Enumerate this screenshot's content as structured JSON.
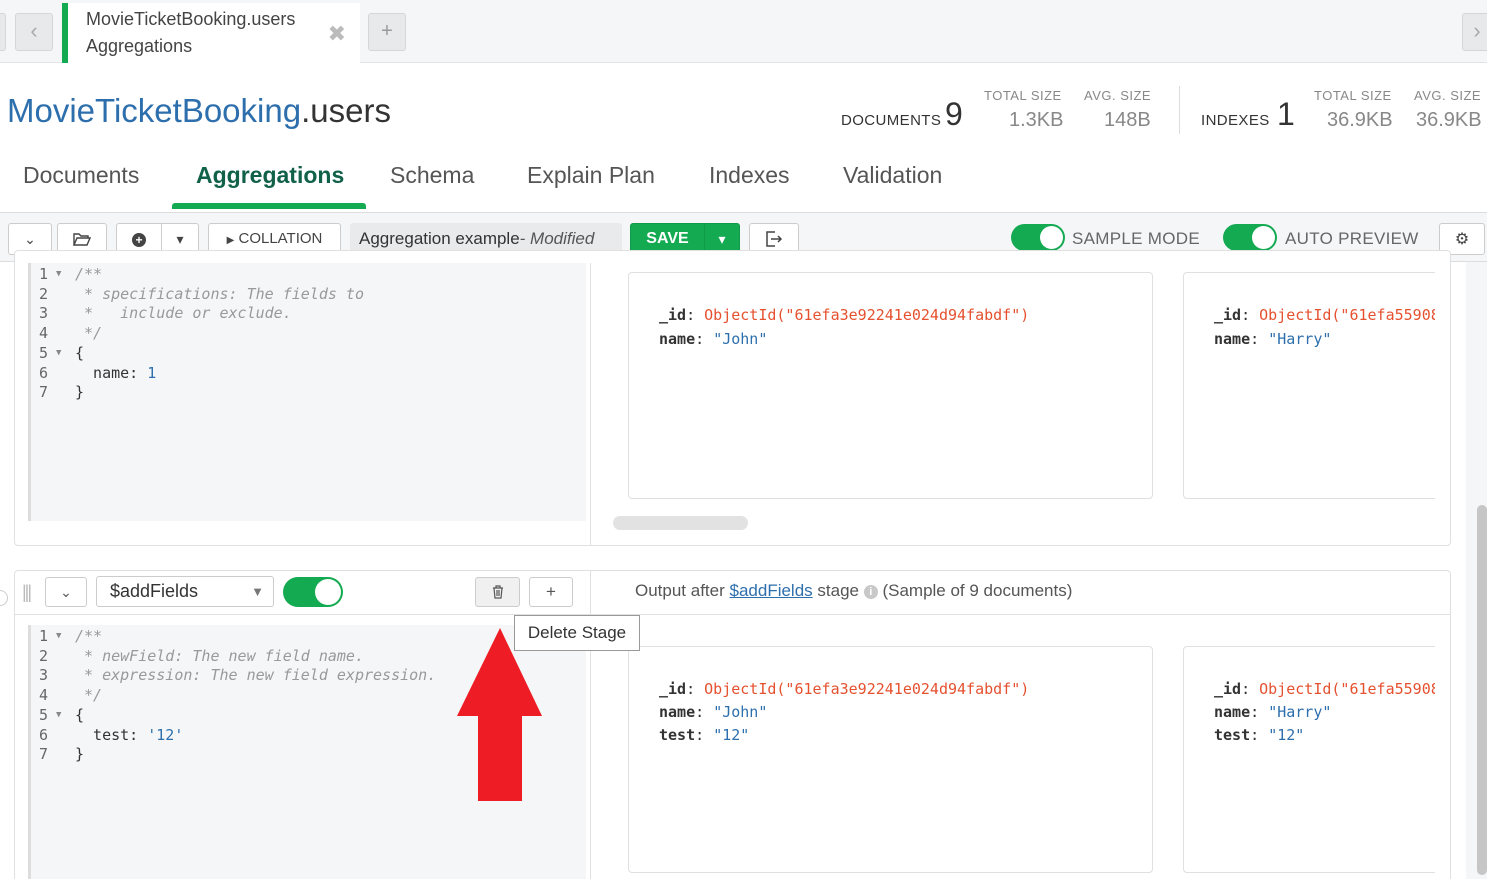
{
  "tabbar": {
    "back_icon": "chevron-left-icon",
    "forward_icon": "chevron-right-icon",
    "active_tab": {
      "namespace": "MovieTicketBooking.users",
      "subtitle": "Aggregations",
      "close_glyph": "✖"
    },
    "add_glyph": "+"
  },
  "header": {
    "db": "MovieTicketBooking",
    "collection": ".users",
    "documents_label": "DOCUMENTS",
    "documents_count": "9",
    "doc_total_size_label": "TOTAL SIZE",
    "doc_total_size": "1.3KB",
    "doc_avg_size_label": "AVG. SIZE",
    "doc_avg_size": "148B",
    "indexes_label": "INDEXES",
    "indexes_count": "1",
    "idx_total_size_label": "TOTAL SIZE",
    "idx_total_size": "36.9KB",
    "idx_avg_size_label": "AVG. SIZE",
    "idx_avg_size": "36.9KB"
  },
  "subtabs": {
    "documents": "Documents",
    "aggregations": "Aggregations",
    "schema": "Schema",
    "explain": "Explain Plan",
    "indexes": "Indexes",
    "validation": "Validation"
  },
  "toolbar": {
    "collation": "COLLATION",
    "pipeline_name": "Aggregation example",
    "modified": "- Modified",
    "save": "SAVE",
    "sample_mode": "SAMPLE MODE",
    "auto_preview": "AUTO PREVIEW"
  },
  "stage1": {
    "code": [
      {
        "n": "1",
        "text": "/**"
      },
      {
        "n": "2",
        "text": " * specifications: The fields to"
      },
      {
        "n": "3",
        "text": " *   include or exclude."
      },
      {
        "n": "4",
        "text": " */"
      },
      {
        "n": "5",
        "text": "{"
      },
      {
        "n": "6",
        "key": "  name: ",
        "val": "1"
      },
      {
        "n": "7",
        "text": "}"
      }
    ],
    "docs": [
      {
        "id": "ObjectId(\"61efa3e92241e024d94fabdf\")",
        "name": "\"John\""
      },
      {
        "id": "ObjectId(\"61efa55908",
        "name": "\"Harry\""
      }
    ]
  },
  "stage2": {
    "operator": "$addFields",
    "output_prefix": "Output after ",
    "output_stage": "$addFields",
    "output_suffix": " stage",
    "sample_note": "(Sample of 9 documents)",
    "tooltip": "Delete Stage",
    "add_glyph": "+",
    "code": [
      {
        "n": "1",
        "text": "/**"
      },
      {
        "n": "2",
        "text": " * newField: The new field name."
      },
      {
        "n": "3",
        "text": " * expression: The new field expression."
      },
      {
        "n": "4",
        "text": " */"
      },
      {
        "n": "5",
        "text": "{"
      },
      {
        "n": "6",
        "key": "  test: ",
        "val": "'12'"
      },
      {
        "n": "7",
        "text": "}"
      }
    ],
    "docs": [
      {
        "id": "ObjectId(\"61efa3e92241e024d94fabdf\")",
        "name": "\"John\"",
        "test": "\"12\""
      },
      {
        "id": "ObjectId(\"61efa55908",
        "name": "\"Harry\"",
        "test": "\"12\""
      }
    ]
  },
  "field_labels": {
    "id": "_id",
    "name": "name",
    "test": "test"
  },
  "colors": {
    "brand_green": "#13aa52",
    "link_blue": "#2d6fad",
    "oid_orange": "#e5512f",
    "annotation_red": "#ee1c25"
  }
}
